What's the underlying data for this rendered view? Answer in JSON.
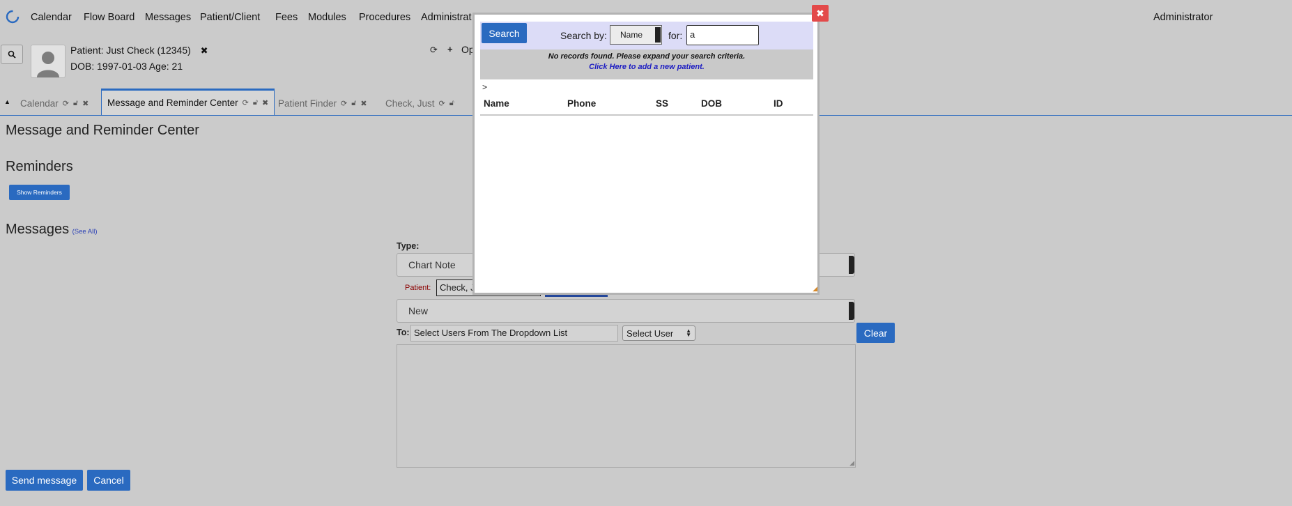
{
  "nav": {
    "items": [
      "Calendar",
      "Flow Board",
      "Messages",
      "Patient/Client",
      "Fees",
      "Modules",
      "Procedures",
      "Administrat"
    ],
    "user": "Administrator"
  },
  "patient": {
    "name_label": "Patient:",
    "name": "Just Check (12345)",
    "dob_line": "DOB: 1997-01-03 Age: 21",
    "open_label": "Op"
  },
  "tabs": [
    {
      "label": "Calendar"
    },
    {
      "label": "Message and Reminder Center",
      "active": true
    },
    {
      "label": "Patient Finder"
    },
    {
      "label": "Check, Just"
    }
  ],
  "page": {
    "title": "Message and Reminder Center",
    "reminders_heading": "Reminders",
    "show_reminders": "Show Reminders",
    "messages_heading": "Messages",
    "see_all": "(See All)"
  },
  "form": {
    "type_label": "Type:",
    "type_value": "Chart Note",
    "patient_label": "Patient:",
    "patient_value": "Check, Ju",
    "status_value": "New",
    "to_label": "To:",
    "to_value": "Select Users From The Dropdown List",
    "select_user": "Select User",
    "clear": "Clear",
    "send": "Send message",
    "cancel": "Cancel"
  },
  "modal": {
    "search_button": "Search",
    "search_by_label": "Search by:",
    "search_by_value": "Name",
    "for_label": "for:",
    "for_value": "a",
    "notice": "No records found. Please expand your search criteria.",
    "add_link": "Click Here to add a new patient.",
    "caret": ">",
    "columns": [
      "Name",
      "Phone",
      "SS",
      "DOB",
      "ID"
    ],
    "close": "✖"
  },
  "colors": {
    "accent": "#2a6ac0",
    "close_red": "#e34a4a",
    "patient_label_red": "#8b0000"
  }
}
